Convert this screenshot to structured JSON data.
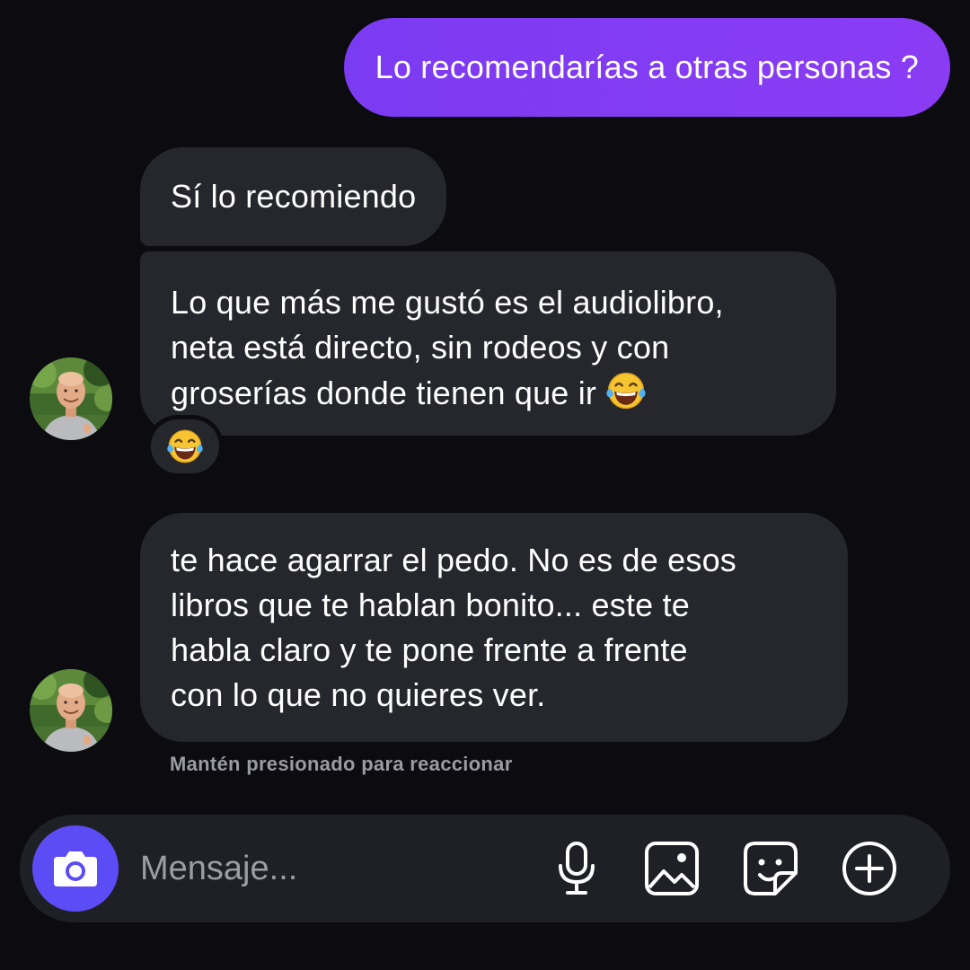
{
  "conversation": {
    "outgoing_message": "Lo recomendarías a otras personas ?",
    "incoming_messages": [
      {
        "text": "Sí lo recomiendo"
      },
      {
        "text_lines": [
          "Lo que más me gustó es el audiolibro,",
          "neta está directo, sin rodeos y con",
          "groserías donde tienen que ir"
        ],
        "emoji": "face-with-tears-of-joy-emoji",
        "reaction": "face-with-tears-of-joy-emoji"
      },
      {
        "text_lines": [
          "te hace agarrar el pedo. No es de esos",
          "libros que te hablan bonito... este te",
          "habla claro y te pone frente a frente",
          "con lo que no quieres ver."
        ]
      }
    ],
    "reaction_hint": "Mantén presionado para reaccionar"
  },
  "composer": {
    "placeholder": "Mensaje...",
    "icons": [
      "camera-icon",
      "microphone-icon",
      "image-icon",
      "sticker-icon",
      "add-icon"
    ]
  },
  "colors": {
    "background": "#0b0b10",
    "outgoing_bubble": "#8a3cf3",
    "incoming_bubble": "#26272d",
    "composer": "#1f2025",
    "camera_button": "#5b4cf5",
    "hint_text": "#9a9ba3"
  }
}
